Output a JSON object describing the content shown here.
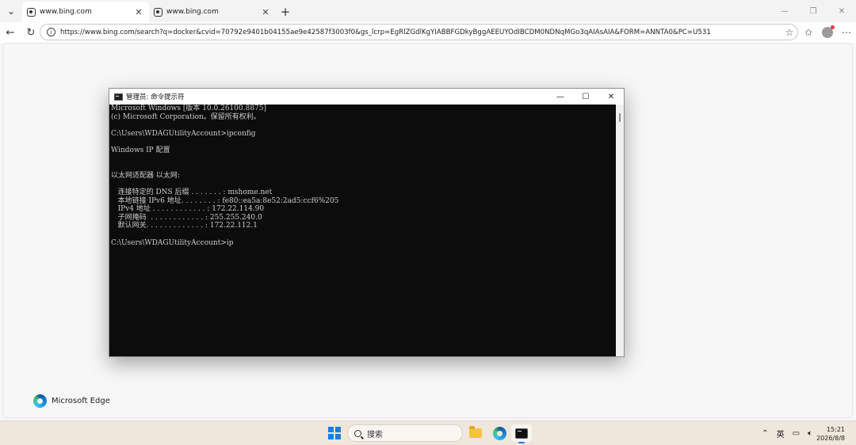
{
  "browser": {
    "tabs": [
      {
        "title": "www.bing.com",
        "active": true
      },
      {
        "title": "www.bing.com",
        "active": false
      }
    ],
    "new_tab_label": "+",
    "url": "https://www.bing.com/search?q=docker&cvid=70792e9401b04155ae9e42587f3003f0&gs_lcrp=EgRlZGdlKgYIABBFGDkyBggAEEUYOdIBCDM0NDNqMGo3qAIAsAIA&FORM=ANNTA0&PC=U531"
  },
  "page": {
    "brand": "Microsoft Edge"
  },
  "cmd": {
    "title": "管理员: 命令提示符",
    "lines": [
      "Microsoft Windows [版本 10.0.26100.8875]",
      "(c) Microsoft Corporation。保留所有权利。",
      "",
      "C:\\Users\\WDAGUtilityAccount>ipconfig",
      "",
      "Windows IP 配置",
      "",
      "",
      "以太网适配器 以太网:",
      "",
      "   连接特定的 DNS 后缀 . . . . . . . : mshome.net",
      "   本地链接 IPv6 地址. . . . . . . . : fe80::ea5a:8e52:2ad5:ccf6%205",
      "   IPv4 地址 . . . . . . . . . . . . : 172.22.114.90",
      "   子网掩码  . . . . . . . . . . . . : 255.255.240.0",
      "   默认网关. . . . . . . . . . . . . : 172.22.112.1",
      "",
      "C:\\Users\\WDAGUtilityAccount>ip"
    ]
  },
  "taskbar": {
    "search_label": "搜索",
    "ime_label": "英",
    "time": "15:21",
    "date": "2026/8/8"
  }
}
